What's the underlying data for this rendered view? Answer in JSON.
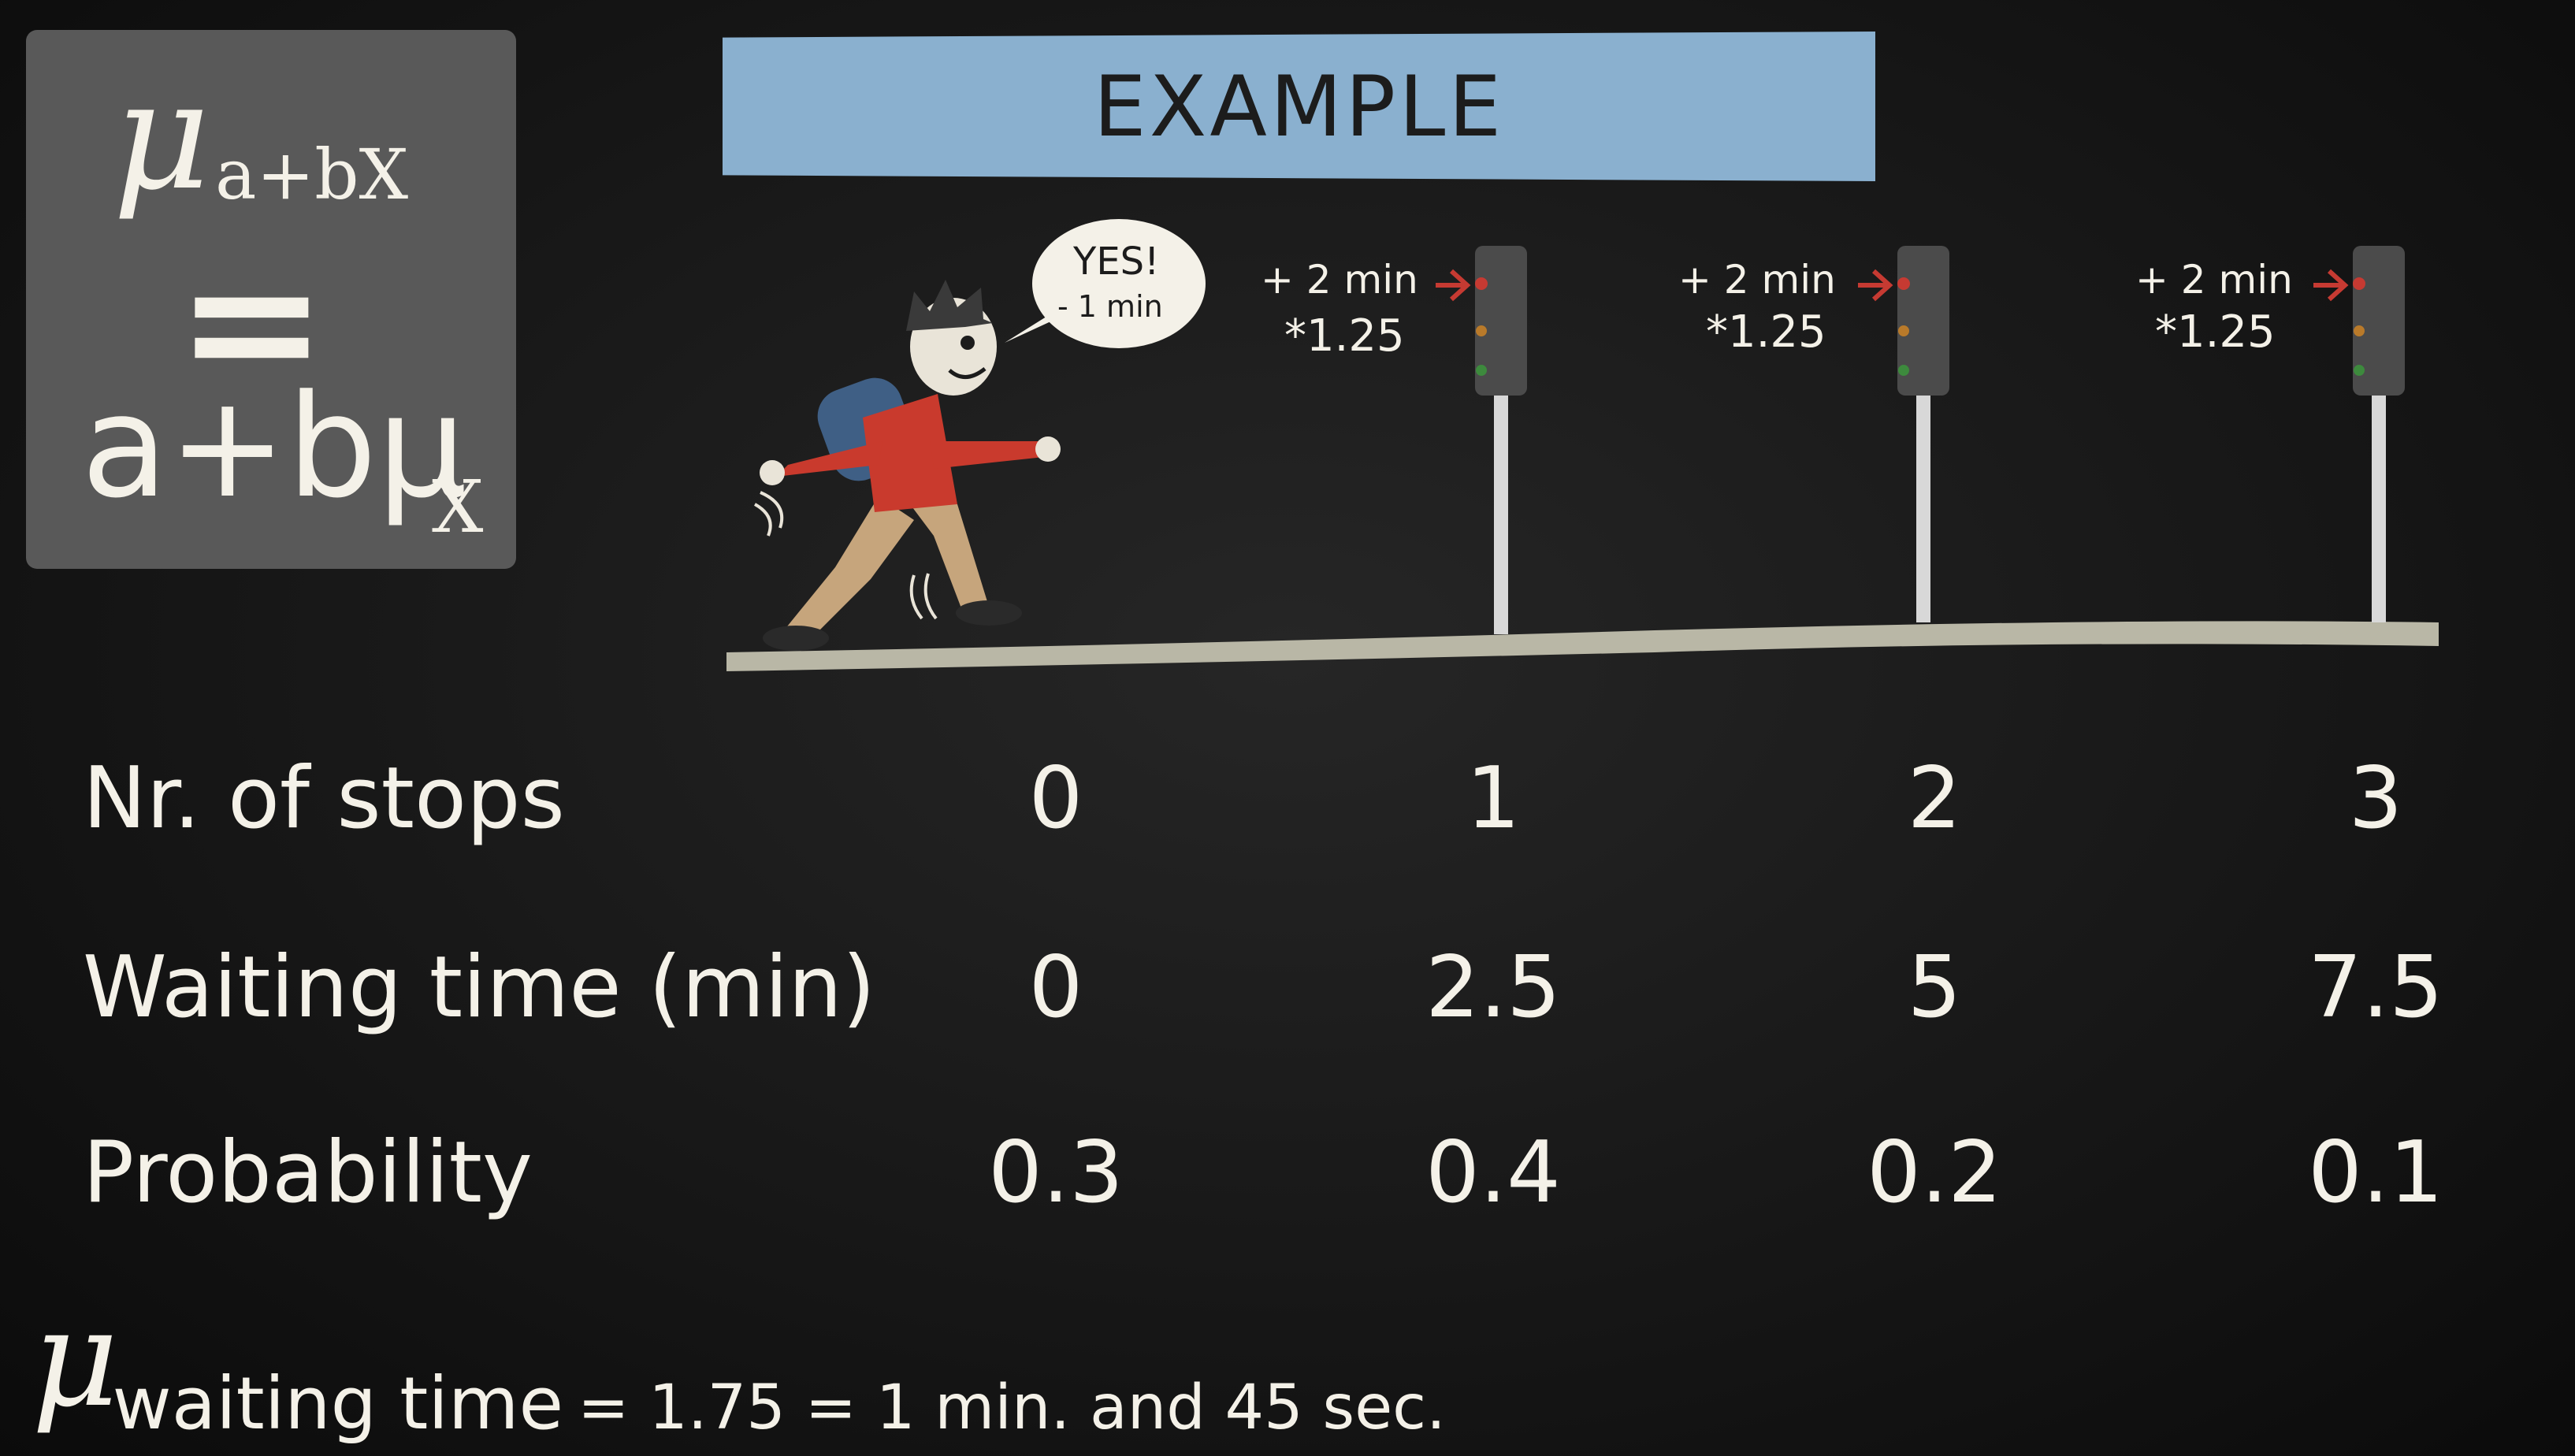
{
  "formula": {
    "mu_symbol": "μ",
    "lhs_subscript": "a+bX",
    "equals": "=",
    "rhs": "a+bμ",
    "rhs_subscript": "X"
  },
  "banner": {
    "title": "EXAMPLE"
  },
  "speech_bubble": {
    "line1": "YES!",
    "line2": "- 1 min"
  },
  "traffic_lights": [
    {
      "line1": "+ 2 min",
      "line2": "*1.25"
    },
    {
      "line1": "+ 2 min",
      "line2": "*1.25"
    },
    {
      "line1": "+ 2 min",
      "line2": "*1.25"
    }
  ],
  "table": {
    "rows": [
      {
        "label": "Nr. of stops",
        "values": [
          "0",
          "1",
          "2",
          "3"
        ]
      },
      {
        "label": "Waiting time (min)",
        "values": [
          "0",
          "2.5",
          "5",
          "7.5"
        ]
      },
      {
        "label": "Probability",
        "values": [
          "0.3",
          "0.4",
          "0.2",
          "0.1"
        ]
      }
    ]
  },
  "mean": {
    "symbol": "μ",
    "subscript": "waiting time",
    "rest": "= 1.75 = 1 min. and 45 sec."
  },
  "colors": {
    "banner": "#8ab0cf",
    "formula_box": "#595959",
    "chalk": "#f4f1e8",
    "ground": "#b9b7a6",
    "jacket": "#c93a2d",
    "backpack": "#3f5f85",
    "pants": "#c6a57c",
    "arrow": "#c63a32"
  }
}
